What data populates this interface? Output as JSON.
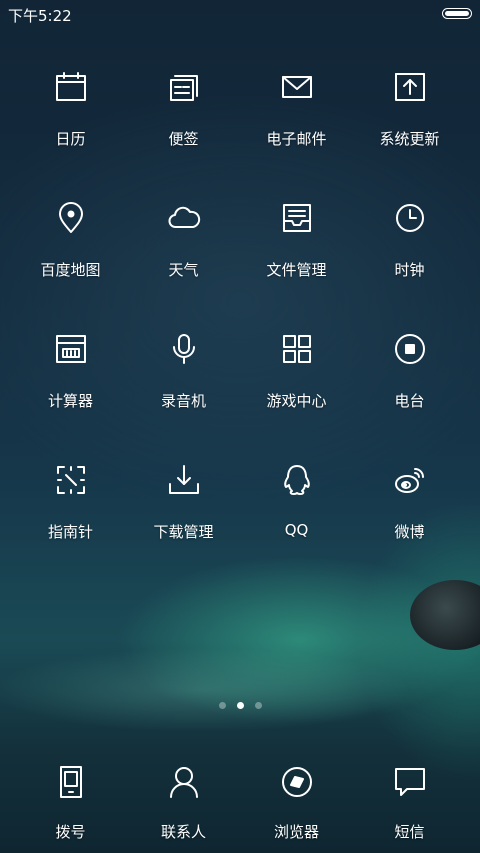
{
  "status_bar": {
    "time": "下午5:22",
    "battery_icon": "battery-icon"
  },
  "apps": [
    {
      "label": "日历",
      "icon": "calendar-icon"
    },
    {
      "label": "便签",
      "icon": "notes-icon"
    },
    {
      "label": "电子邮件",
      "icon": "mail-icon"
    },
    {
      "label": "系统更新",
      "icon": "update-icon"
    },
    {
      "label": "百度地图",
      "icon": "map-pin-icon"
    },
    {
      "label": "天气",
      "icon": "cloud-icon"
    },
    {
      "label": "文件管理",
      "icon": "file-tray-icon"
    },
    {
      "label": "时钟",
      "icon": "clock-icon"
    },
    {
      "label": "计算器",
      "icon": "calculator-icon"
    },
    {
      "label": "录音机",
      "icon": "microphone-icon"
    },
    {
      "label": "游戏中心",
      "icon": "grid-icon"
    },
    {
      "label": "电台",
      "icon": "radio-icon"
    },
    {
      "label": "指南针",
      "icon": "compass-icon"
    },
    {
      "label": "下载管理",
      "icon": "download-icon"
    },
    {
      "label": "QQ",
      "icon": "qq-penguin-icon"
    },
    {
      "label": "微博",
      "icon": "weibo-icon"
    }
  ],
  "page_indicator": {
    "count": 3,
    "active": 2
  },
  "dock": [
    {
      "label": "拨号",
      "icon": "phone-icon"
    },
    {
      "label": "联系人",
      "icon": "contact-icon"
    },
    {
      "label": "浏览器",
      "icon": "browser-icon"
    },
    {
      "label": "短信",
      "icon": "message-icon"
    }
  ]
}
